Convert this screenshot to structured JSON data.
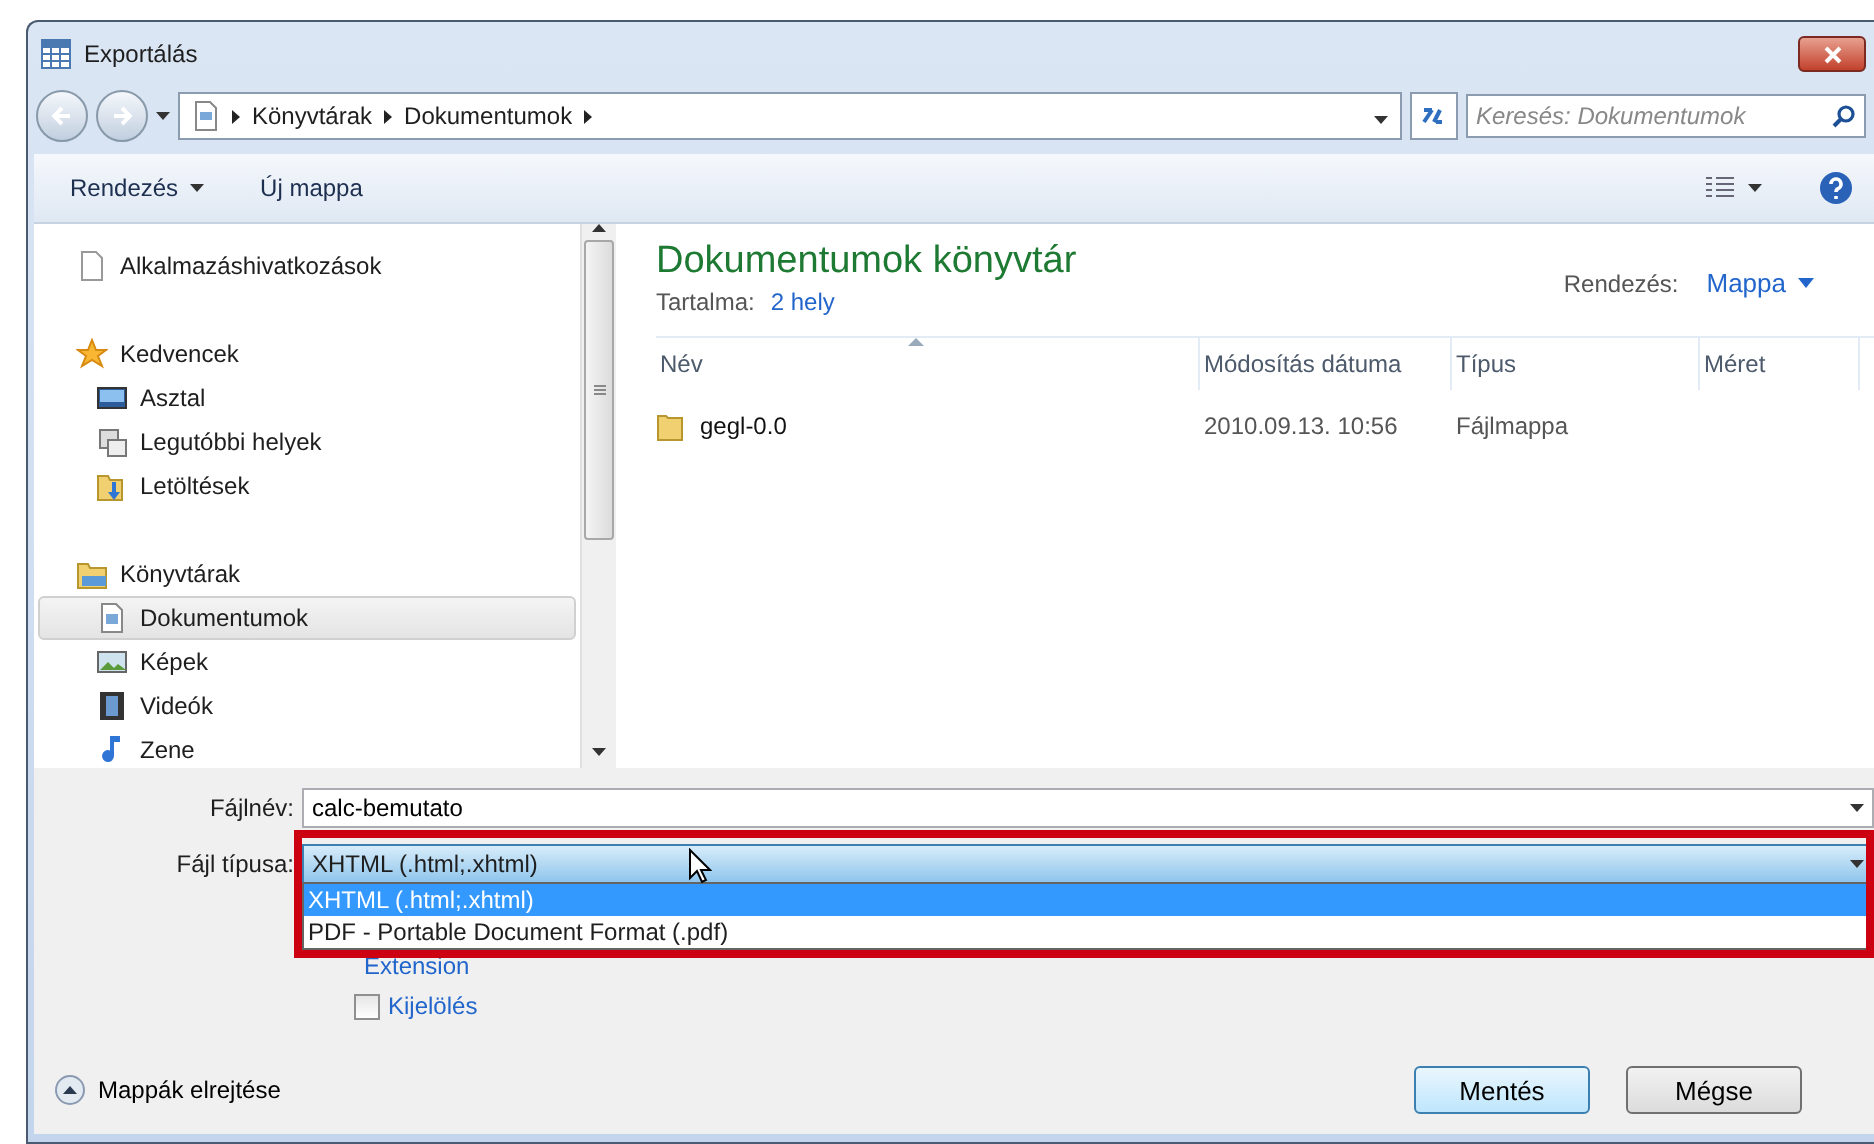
{
  "window": {
    "title": "Exportálás"
  },
  "address": {
    "crumbs": [
      "Könyvtárak",
      "Dokumentumok"
    ]
  },
  "search": {
    "placeholder": "Keresés: Dokumentumok"
  },
  "toolbar": {
    "buttons": [
      "Rendezés",
      "Új mappa"
    ]
  },
  "sidebar": {
    "items": [
      {
        "label": "Alkalmazáshivatkozások",
        "kind": "header",
        "selected": false
      },
      {
        "label": "Kedvencek",
        "kind": "header",
        "selected": false
      },
      {
        "label": "Asztal",
        "kind": "item",
        "selected": false
      },
      {
        "label": "Legutóbbi helyek",
        "kind": "item",
        "selected": false
      },
      {
        "label": "Letöltések",
        "kind": "item",
        "selected": false
      },
      {
        "label": "Könyvtárak",
        "kind": "header",
        "selected": false
      },
      {
        "label": "Dokumentumok",
        "kind": "item",
        "selected": true
      },
      {
        "label": "Képek",
        "kind": "item",
        "selected": false
      },
      {
        "label": "Videók",
        "kind": "item",
        "selected": false
      },
      {
        "label": "Zene",
        "kind": "item",
        "selected": false
      }
    ]
  },
  "library": {
    "title": "Dokumentumok könyvtár",
    "contains_label": "Tartalma:",
    "contains_link": "2 hely",
    "arrange_label": "Rendezés:",
    "arrange_value": "Mappa"
  },
  "table": {
    "columns": [
      "Név",
      "Módosítás dátuma",
      "Típus",
      "Méret"
    ],
    "rows": [
      {
        "name": "gegl-0.0",
        "date": "2010.09.13. 10:56",
        "type": "Fájlmappa"
      }
    ]
  },
  "form": {
    "filename_label": "Fájlnév:",
    "filename": "calc-bemutato",
    "type_label": "Fájl típusa:",
    "type_value": "XHTML (.html;.xhtml)",
    "type_options": [
      {
        "label": "XHTML (.html;.xhtml)",
        "selected": true
      },
      {
        "label": "PDF - Portable Document Format (.pdf)",
        "selected": false
      }
    ],
    "extension_link": "Extension",
    "selection_checkbox": {
      "label": "Kijelölés",
      "checked": false
    }
  },
  "hide_folders": "Mappák elrejtése",
  "buttons": [
    "Mentés",
    "Mégse"
  ]
}
